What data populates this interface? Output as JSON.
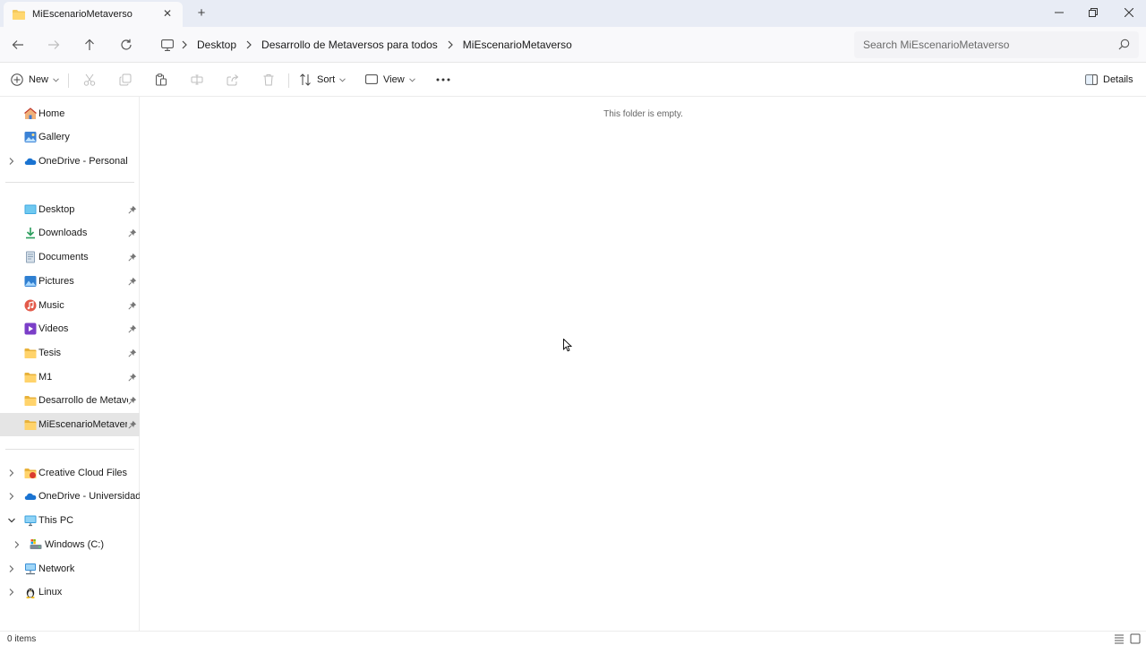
{
  "window": {
    "tab_title": "MiEscenarioMetaverso",
    "new_tab_symbol": "+",
    "close_tab_symbol": "✕"
  },
  "address": {
    "breadcrumbs": [
      "Desktop",
      "Desarrollo de Metaversos para todos",
      "MiEscenarioMetaverso"
    ],
    "search_placeholder": "Search MiEscenarioMetaverso"
  },
  "commands": {
    "new_label": "New",
    "sort_label": "Sort",
    "view_label": "View",
    "details_label": "Details"
  },
  "sidebar": {
    "top": [
      {
        "label": "Home",
        "icon": "home-icon"
      },
      {
        "label": "Gallery",
        "icon": "gallery-icon"
      },
      {
        "label": "OneDrive - Personal",
        "icon": "onedrive-icon"
      }
    ],
    "pinned": [
      {
        "label": "Desktop",
        "icon": "desktop-folder-icon"
      },
      {
        "label": "Downloads",
        "icon": "downloads-icon"
      },
      {
        "label": "Documents",
        "icon": "documents-icon"
      },
      {
        "label": "Pictures",
        "icon": "pictures-icon"
      },
      {
        "label": "Music",
        "icon": "music-icon"
      },
      {
        "label": "Videos",
        "icon": "videos-icon"
      },
      {
        "label": "Tesis",
        "icon": "folder-icon"
      },
      {
        "label": "M1",
        "icon": "folder-icon"
      },
      {
        "label": "Desarrollo de Metaver",
        "icon": "folder-icon"
      },
      {
        "label": "MiEscenarioMetaverso",
        "icon": "folder-icon"
      }
    ],
    "bottom": [
      {
        "label": "Creative Cloud Files",
        "icon": "creative-cloud-icon"
      },
      {
        "label": "OneDrive - Universidad d",
        "icon": "onedrive-icon"
      },
      {
        "label": "This PC",
        "icon": "this-pc-icon"
      },
      {
        "label": "Windows (C:)",
        "icon": "drive-icon"
      },
      {
        "label": "Network",
        "icon": "network-icon"
      },
      {
        "label": "Linux",
        "icon": "linux-icon"
      }
    ]
  },
  "content": {
    "empty_message": "This folder is empty."
  },
  "status": {
    "item_count": "0 items"
  },
  "colors": {
    "folder": "#f4c95d",
    "accent": "#0067c0",
    "selected": "#e5e5e5"
  }
}
